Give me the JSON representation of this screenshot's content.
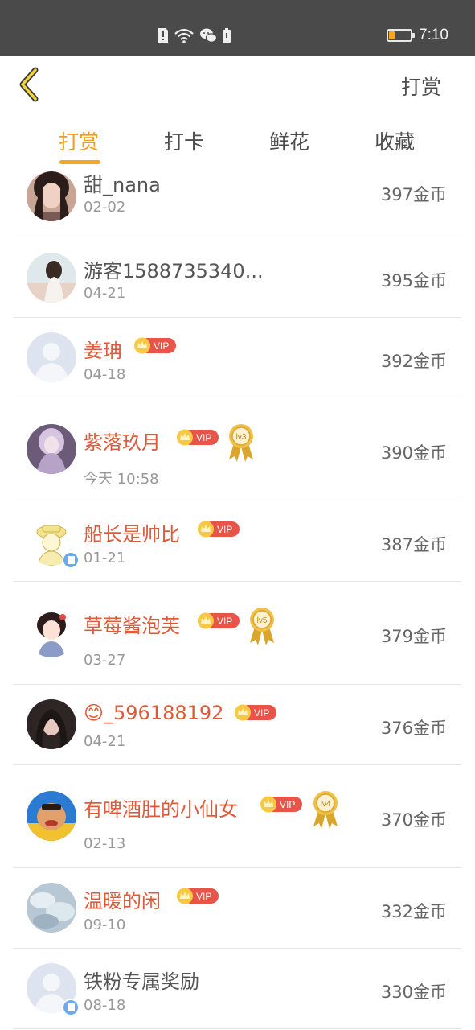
{
  "status_bar": {
    "time": "7:10",
    "icons": [
      "sim-alert-icon",
      "wifi-icon",
      "wechat-icon",
      "battery-small-icon"
    ]
  },
  "header": {
    "action_label": "打赏"
  },
  "tabs": [
    {
      "label": "打赏",
      "active": true
    },
    {
      "label": "打卡",
      "active": false
    },
    {
      "label": "鲜花",
      "active": false
    },
    {
      "label": "收藏",
      "active": false
    }
  ],
  "list": [
    {
      "name": "甜_nana",
      "date": "02-02",
      "coins": "397金币",
      "vip": false
    },
    {
      "name": "游客1588735340...",
      "date": "04-21",
      "coins": "395金币",
      "vip": false
    },
    {
      "name": "姜珃",
      "date": "04-18",
      "coins": "392金币",
      "vip": true,
      "vip_label": "VIP"
    },
    {
      "name": "紫落玖月",
      "date": "今天 10:58",
      "coins": "390金币",
      "vip": true,
      "vip_label": "VIP",
      "medal": "lv3"
    },
    {
      "name": "船长是帅比",
      "date": "01-21",
      "coins": "387金币",
      "vip": true,
      "vip_label": "VIP"
    },
    {
      "name": "草莓酱泡芙",
      "date": "03-27",
      "coins": "379金币",
      "vip": true,
      "vip_label": "VIP",
      "medal": "lv5"
    },
    {
      "name": "😊_596188192",
      "date": "04-21",
      "coins": "376金币",
      "vip": true,
      "vip_label": "VIP"
    },
    {
      "name": "有啤酒肚的小仙女",
      "date": "02-13",
      "coins": "370金币",
      "vip": true,
      "vip_label": "VIP",
      "medal": "lv4"
    },
    {
      "name": "温暖的闲",
      "date": "09-10",
      "coins": "332金币",
      "vip": true,
      "vip_label": "VIP"
    },
    {
      "name": "铁粉专属奖励",
      "date": "08-18",
      "coins": "330金币",
      "vip": false
    }
  ],
  "colors": {
    "accent": "#f5a623",
    "vip_name": "#e05a3a",
    "vip_badge": "#e8544a",
    "status_bar": "#4a4a4a"
  }
}
